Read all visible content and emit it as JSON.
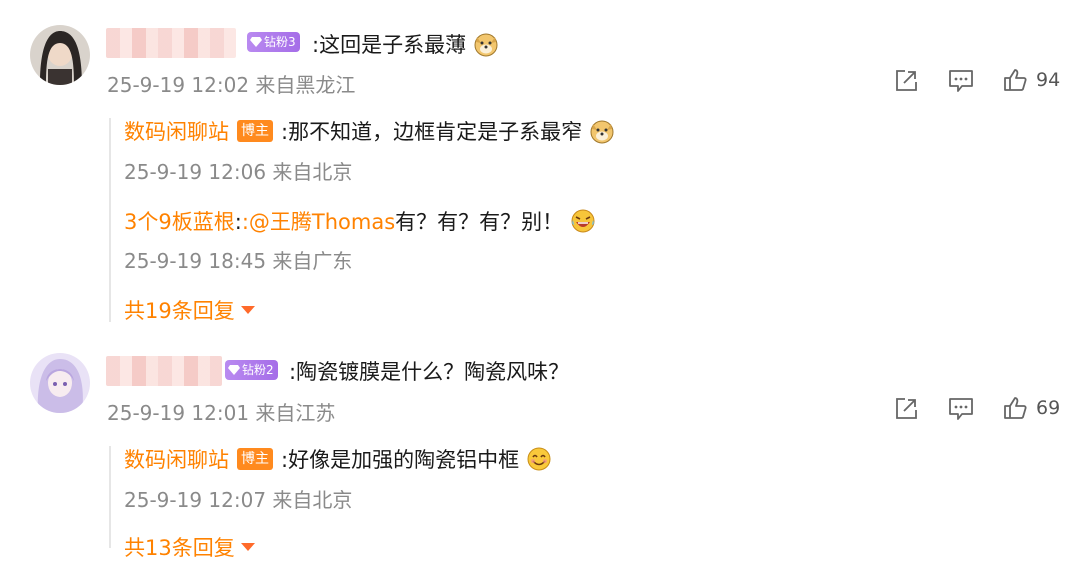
{
  "comments": [
    {
      "badge": "钻粉3",
      "text": ":这回是子系最薄",
      "emoji": "doge-emoji",
      "time": "25-9-19 12:02 来自黑龙江",
      "likes": "94",
      "replies": [
        {
          "name": "数码闲聊站",
          "badge": "博主",
          "text": ":那不知道，边框肯定是子系最窄",
          "emoji": "doge-emoji",
          "time": "25-9-19 12:06 来自北京"
        },
        {
          "name": "3个9板蓝根",
          "mention": ":@王腾Thomas",
          "text": " 有？有？有？别！",
          "emoji": "laughing-tears-emoji",
          "time": "25-9-19 18:45 来自广东"
        }
      ],
      "more": "共19条回复"
    },
    {
      "badge": "钻粉2",
      "text": ":陶瓷镀膜是什么？陶瓷风味？",
      "time": "25-9-19 12:01 来自江苏",
      "likes": "69",
      "replies": [
        {
          "name": "数码闲聊站",
          "badge": "博主",
          "text": ":好像是加强的陶瓷铝中框",
          "emoji": "smile-emoji",
          "time": "25-9-19 12:07 来自北京"
        }
      ],
      "more": "共13条回复"
    }
  ],
  "colors": {
    "accent": "#ff8200",
    "badge_fan": "#a56de8",
    "badge_host": "#ff8a1e",
    "meta": "#8a8a8a"
  }
}
